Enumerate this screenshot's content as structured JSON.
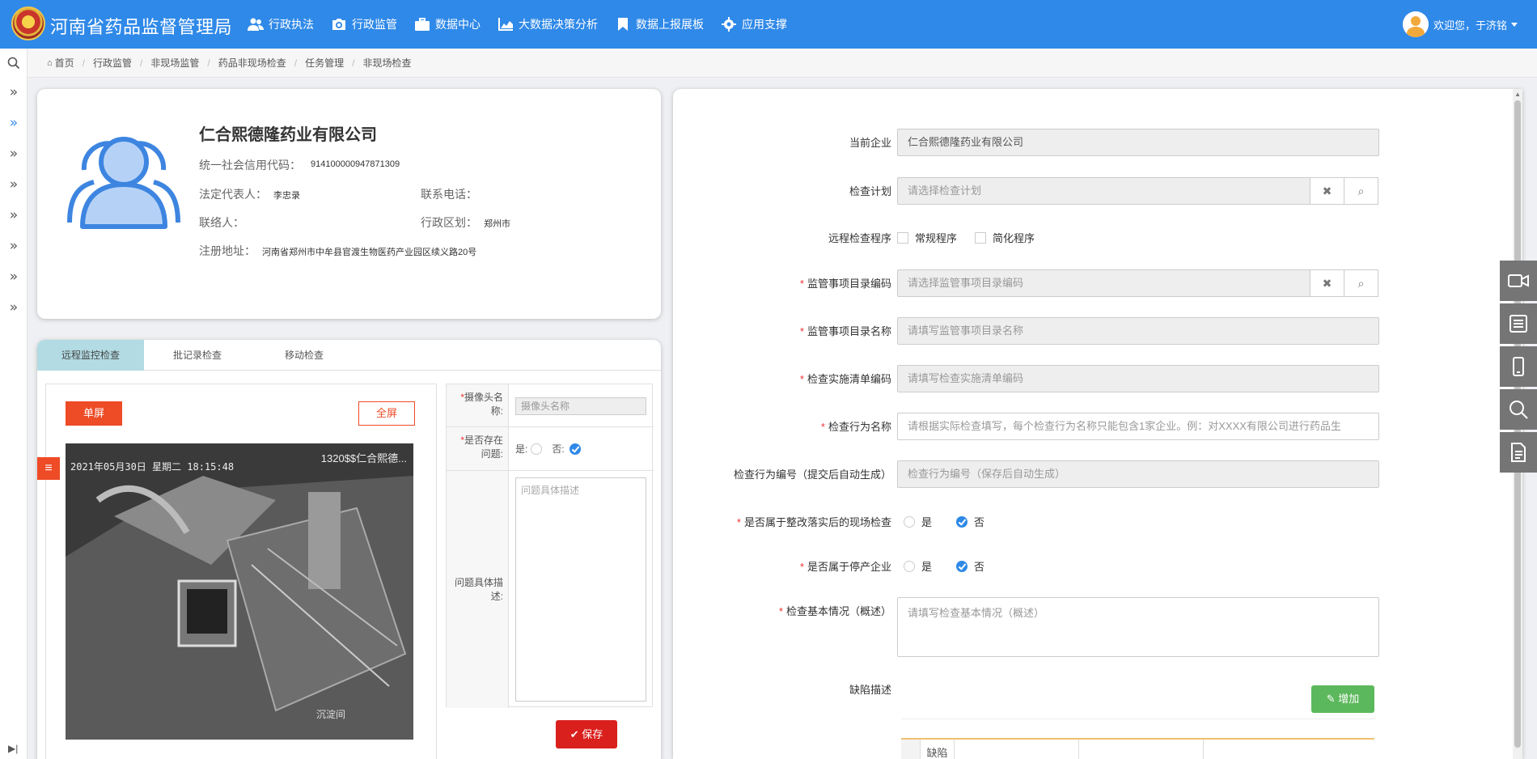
{
  "header": {
    "app_title": "河南省药品监督管理局",
    "nav": [
      {
        "label": "行政执法",
        "icon": "users-icon"
      },
      {
        "label": "行政监管",
        "icon": "camera-icon"
      },
      {
        "label": "数据中心",
        "icon": "briefcase-icon"
      },
      {
        "label": "大数据决策分析",
        "icon": "area-chart-icon"
      },
      {
        "label": "数据上报展板",
        "icon": "bookmark-icon"
      },
      {
        "label": "应用支撑",
        "icon": "gear-icon"
      }
    ],
    "user_greeting": "欢迎您，于济铭"
  },
  "breadcrumb": [
    "首页",
    "行政监管",
    "非现场监管",
    "药品非现场检查",
    "任务管理",
    "非现场检查"
  ],
  "company": {
    "name": "仁合熙德隆药业有限公司",
    "credit_code_label": "统一社会信用代码：",
    "credit_code": "914100000947871309",
    "legal_rep_label": "法定代表人：",
    "legal_rep": "李忠录",
    "phone_label": "联系电话：",
    "phone": "",
    "contact_label": "联络人：",
    "contact": "",
    "region_label": "行政区划：",
    "region": "郑州市",
    "address_label": "注册地址：",
    "address": "河南省郑州市中牟县官渡生物医药产业园区续义路20号"
  },
  "camera": {
    "tabs": [
      "远程监控检查",
      "批记录检查",
      "移动检查"
    ],
    "single_label": "单屏",
    "full_label": "全屏",
    "timestamp": "2021年05月30日 星期二 18:15:48",
    "cam_name": "1320$$仁合熙德...",
    "watermark": "沉淀间",
    "camera_name_label": "摄像头名称:",
    "camera_name_placeholder": "摄像头名称",
    "has_issue_label": "是否存在问题:",
    "yes": "是:",
    "no": "否:",
    "issue_desc_label": "问题具体描述:",
    "issue_desc_placeholder": "问题具体描述",
    "save_label": "保存"
  },
  "form": {
    "current_company_label": "当前企业",
    "current_company": "仁合熙德隆药业有限公司",
    "plan_label": "检查计划",
    "plan_placeholder": "请选择检查计划",
    "program_label": "远程检查程序",
    "program_opt1": "常规程序",
    "program_opt2": "简化程序",
    "item_code_label": "监管事项目录编码",
    "item_code_placeholder": "请选择监管事项目录编码",
    "item_name_label": "监管事项目录名称",
    "item_name_placeholder": "请填写监管事项目录名称",
    "list_code_label": "检查实施清单编码",
    "list_code_placeholder": "请填写检查实施清单编码",
    "action_name_label": "检查行为名称",
    "action_name_placeholder": "请根据实际检查填写，每个检查行为名称只能包含1家企业。例：对XXXX有限公司进行药品生",
    "action_no_label": "检查行为编号（提交后自动生成）",
    "action_no_placeholder": "检查行为编号（保存后自动生成）",
    "rectify_label": "是否属于整改落实后的现场检查",
    "stopped_label": "是否属于停产企业",
    "yes": "是",
    "no": "否",
    "basic_label": "检查基本情况（概述）",
    "basic_placeholder": "请填写检查基本情况（概述）",
    "defect_label": "缺陷描述",
    "add_label": "增加",
    "defect_col1": "缺陷"
  }
}
